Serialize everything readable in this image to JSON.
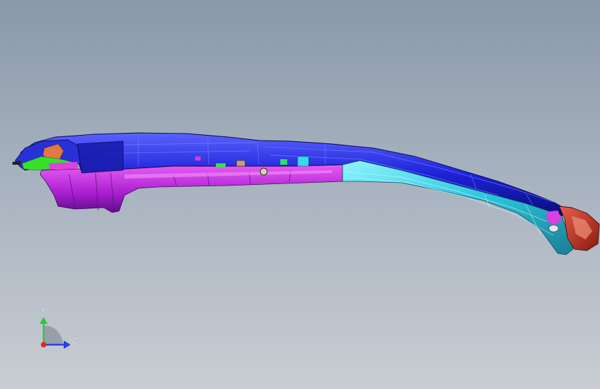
{
  "viewport": {
    "background_top": "#8a98a8",
    "background_bottom": "#c9cdd3",
    "part_colors": {
      "blue": "#2a2ee8",
      "magenta": "#c53ae0",
      "cyan": "#3fe0e8",
      "green": "#2fdc2a",
      "red": "#c8321e"
    }
  },
  "triad": {
    "y_label": "Y",
    "z_label": "Z",
    "y_color": "#2ec83a",
    "z_color": "#2a3ee8",
    "x_color": "#e02828"
  }
}
